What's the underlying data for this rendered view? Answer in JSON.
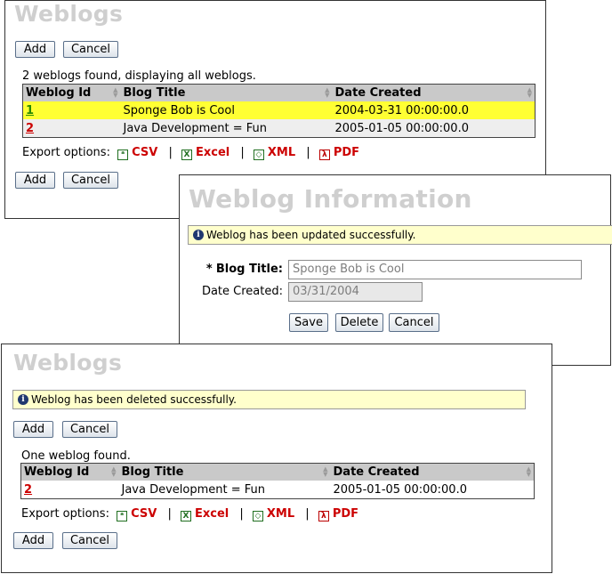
{
  "panel1": {
    "heading": "Weblogs",
    "add": "Add",
    "cancel": "Cancel",
    "status": "2 weblogs found, displaying all weblogs.",
    "columns": [
      "Weblog Id",
      "Blog Title",
      "Date Created"
    ],
    "rows": [
      {
        "id": "1",
        "title": "Sponge Bob is Cool",
        "date": "2004-03-31 00:00:00.0"
      },
      {
        "id": "2",
        "title": "Java Development = Fun",
        "date": "2005-01-05 00:00:00.0"
      }
    ],
    "export": {
      "label": "Export options:",
      "csv": "CSV",
      "excel": "Excel",
      "xml": "XML",
      "pdf": "PDF",
      "sep": "|"
    }
  },
  "panel2": {
    "heading": "Weblog Information",
    "message": "Weblog has been updated successfully.",
    "blog_title_required": "*",
    "blog_title_label": "Blog Title:",
    "blog_title_value": "Sponge Bob is Cool",
    "date_label": "Date Created:",
    "date_value": "03/31/2004",
    "save": "Save",
    "delete": "Delete",
    "cancel": "Cancel"
  },
  "panel3": {
    "heading": "Weblogs",
    "message": "Weblog has been deleted successfully.",
    "add": "Add",
    "cancel": "Cancel",
    "status": "One weblog found.",
    "columns": [
      "Weblog Id",
      "Blog Title",
      "Date Created"
    ],
    "rows": [
      {
        "id": "2",
        "title": "Java Development = Fun",
        "date": "2005-01-05 00:00:00.0"
      }
    ],
    "export": {
      "label": "Export options:",
      "csv": "CSV",
      "excel": "Excel",
      "xml": "XML",
      "pdf": "PDF",
      "sep": "|"
    }
  },
  "icons": {
    "info": "i",
    "csv": "csv-icon",
    "excel": "excel-icon",
    "xml": "xml-icon",
    "pdf": "pdf-icon"
  },
  "colors": {
    "highlight_row": "#ffff33",
    "link_red": "#cc0000",
    "link_green": "#2a8a00",
    "message_bg": "#ffffcc"
  }
}
